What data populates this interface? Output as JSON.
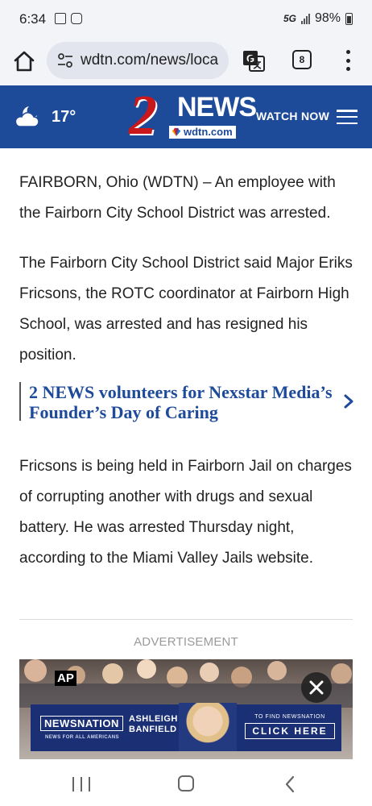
{
  "status_bar": {
    "time": "6:34",
    "network": "5G",
    "battery": "98%"
  },
  "browser": {
    "url": "wdtn.com/news/loca",
    "tab_count": "8"
  },
  "site_header": {
    "temperature": "17°",
    "logo_number": "2",
    "logo_news": "NEWS",
    "logo_site": "wdtn.com",
    "watch_now": "WATCH NOW"
  },
  "article": {
    "paragraph1": "FAIRBORN, Ohio (WDTN) – An employee with the Fairborn City School District was arrested.",
    "paragraph2": "The Fairborn City School District said Major Eriks Fricsons, the ROTC coordinator at Fairborn High School, was arrested and has resigned his position.",
    "related_link": "2 NEWS volunteers for Nexstar Media’s Founder’s Day of Caring",
    "paragraph3": "Fricsons is being held in Fairborn Jail on charges of corrupting another with drugs and sexual battery. He was arrested Thursday night, according to the Miami Valley Jails website."
  },
  "ad": {
    "label": "ADVERTISEMENT",
    "ap_badge": "AP",
    "brand": "NEWSNATION",
    "tagline": "NEWS FOR ALL AMERICANS",
    "host_first": "ASHLEIGH",
    "host_last": "BANFIELD",
    "cta_small": "TO FIND NEWSNATION",
    "cta_big": "CLICK HERE"
  },
  "colors": {
    "header_blue": "#1e4a9a",
    "logo_red": "#c8181b",
    "link_blue": "#1e4a9a",
    "ad_banner": "#1b2f74"
  },
  "icons": [
    "home-icon",
    "tune-icon",
    "translate-icon",
    "tabs-icon",
    "more-vert-icon",
    "weather-cloud-moon-icon",
    "hamburger-menu-icon",
    "chevron-right-icon",
    "close-icon",
    "nav-recents-icon",
    "nav-home-icon",
    "nav-back-icon"
  ]
}
